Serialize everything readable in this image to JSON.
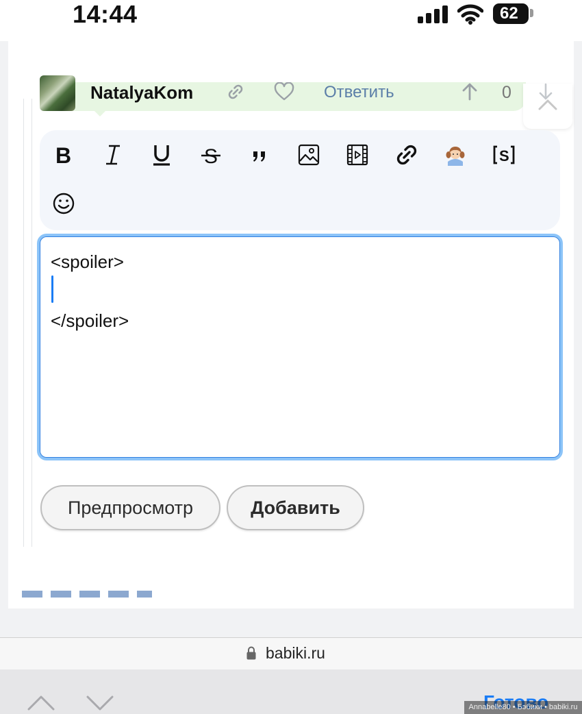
{
  "status_bar": {
    "time": "14:44",
    "battery": "62"
  },
  "comment": {
    "author": "NatalyaKom",
    "reply_label": "Ответить",
    "vote_count": "0"
  },
  "toolbar": {
    "buttons": [
      "bold",
      "italic",
      "underline",
      "strikethrough",
      "quote",
      "image",
      "video",
      "link",
      "emoticon-girl",
      "spoiler",
      "smiley"
    ]
  },
  "editor": {
    "lines": [
      "<spoiler>",
      "",
      "</spoiler>"
    ]
  },
  "actions": {
    "preview_label": "Предпросмотр",
    "add_label": "Добавить"
  },
  "browser": {
    "url": "babiki.ru"
  },
  "keyboard_bar": {
    "done_label": "Готово"
  },
  "watermark": "Annabelle80 • Бэбики • babiki.ru",
  "colors": {
    "accent": "#1a7cf5",
    "reply": "#5b7ea8",
    "toolbar_bg": "#f3f6fb",
    "editor_border": "#8cc4f8"
  }
}
